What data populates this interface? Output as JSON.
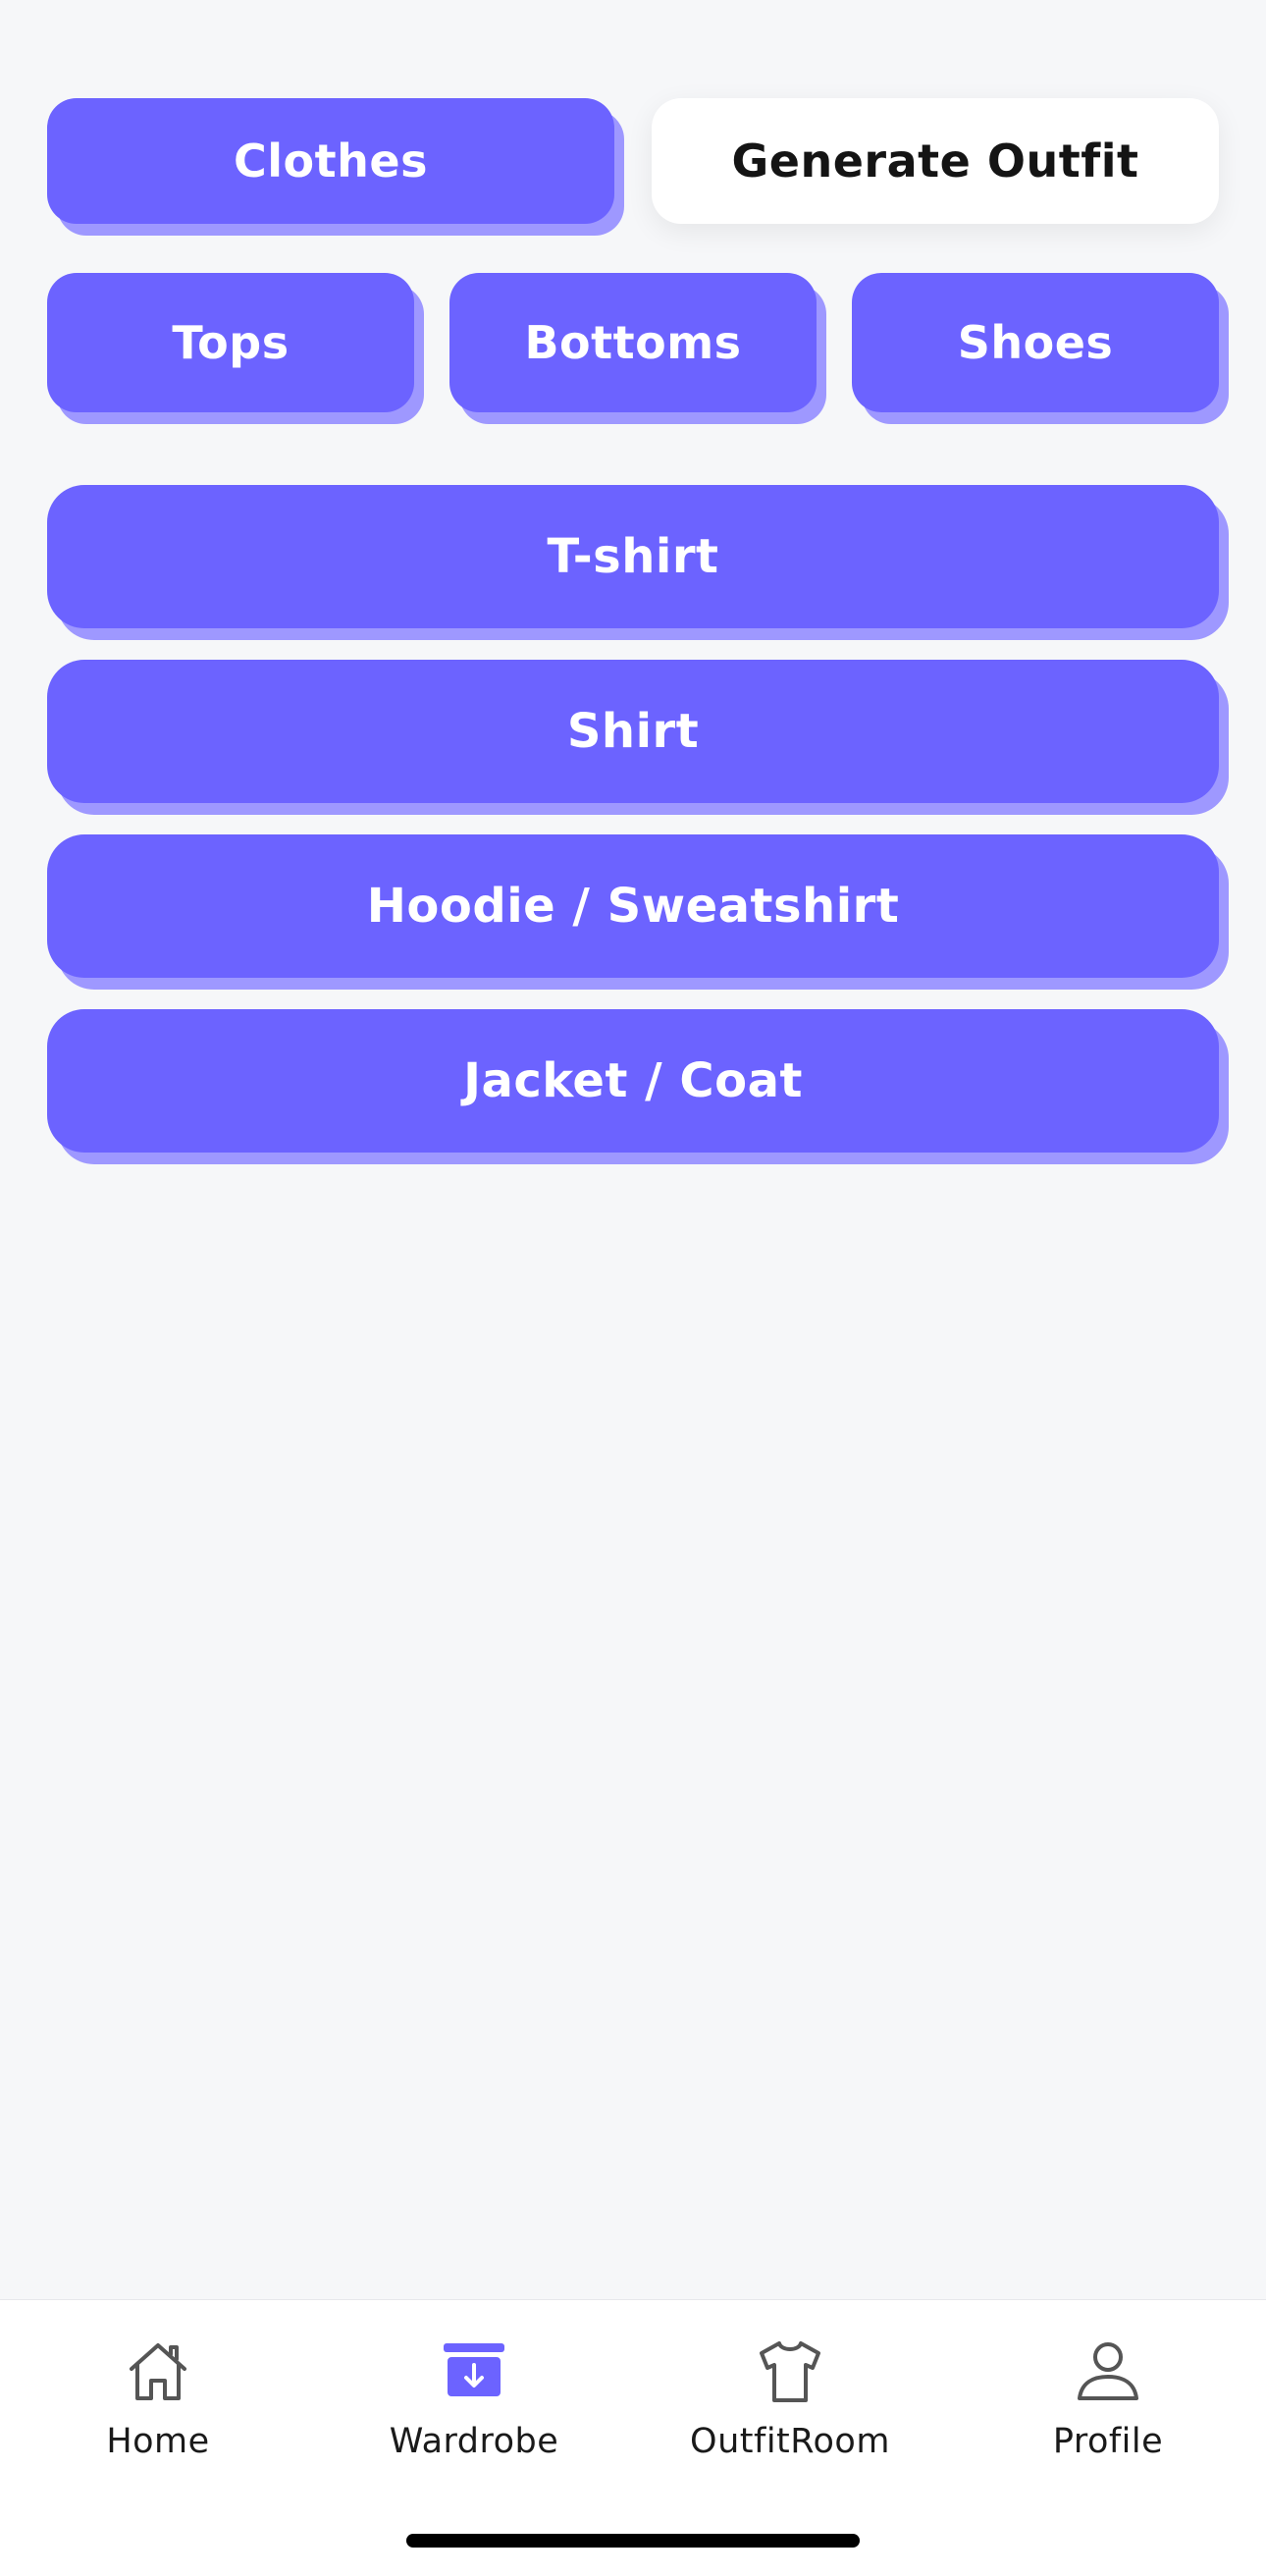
{
  "header": {
    "clothes_label": "Clothes",
    "generate_label": "Generate Outfit"
  },
  "categories": {
    "tops": "Tops",
    "bottoms": "Bottoms",
    "shoes": "Shoes"
  },
  "items": [
    {
      "label": "T-shirt"
    },
    {
      "label": "Shirt"
    },
    {
      "label": "Hoodie / Sweatshirt"
    },
    {
      "label": "Jacket / Coat"
    }
  ],
  "tabs": [
    {
      "label": "Home",
      "icon": "home-icon"
    },
    {
      "label": "Wardrobe",
      "icon": "wardrobe-icon",
      "active": true
    },
    {
      "label": "OutfitRoom",
      "icon": "tshirt-icon"
    },
    {
      "label": "Profile",
      "icon": "profile-icon"
    }
  ],
  "colors": {
    "accent": "#6c63ff",
    "accent_shadow": "#9e98ff",
    "background": "#f6f7f9"
  }
}
